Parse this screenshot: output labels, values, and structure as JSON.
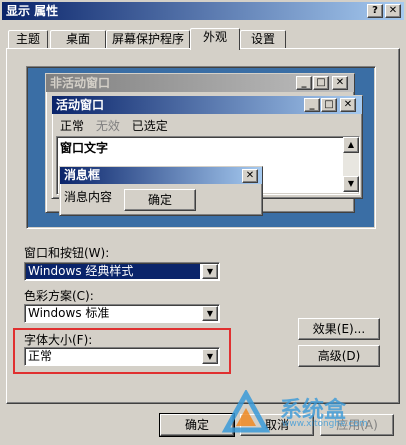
{
  "window": {
    "title": "显示 属性",
    "help_btn": "?",
    "close_btn": "✕"
  },
  "tabs": [
    {
      "label": "主题"
    },
    {
      "label": "桌面"
    },
    {
      "label": "屏幕保护程序"
    },
    {
      "label": "外观",
      "active": true
    },
    {
      "label": "设置"
    }
  ],
  "preview": {
    "inactive_title": "非活动窗口",
    "active_title": "活动窗口",
    "menu": {
      "normal": "正常",
      "disabled": "无效",
      "selected": "已选定"
    },
    "window_text": "窗口文字",
    "msgbox_title": "消息框",
    "msgbox_text": "消息内容",
    "ok_label": "确定",
    "btn_min": "_",
    "btn_max": "□",
    "btn_close": "✕"
  },
  "settings": {
    "windows_buttons_label": "窗口和按钮(W):",
    "windows_buttons_value": "Windows 经典样式",
    "color_scheme_label": "色彩方案(C):",
    "color_scheme_value": "Windows 标准",
    "font_size_label": "字体大小(F):",
    "font_size_value": "正常",
    "effects_label": "效果(E)...",
    "advanced_label": "高级(D)"
  },
  "footer": {
    "ok": "确定",
    "cancel": "取消",
    "apply": "应用(A)"
  },
  "watermark": {
    "brand": "系统盒",
    "url": "www.xitonghe.com"
  },
  "colors": {
    "titlebar": "#0a246a",
    "desktop": "#3a6ea5",
    "highlight_box": "#e03030"
  }
}
